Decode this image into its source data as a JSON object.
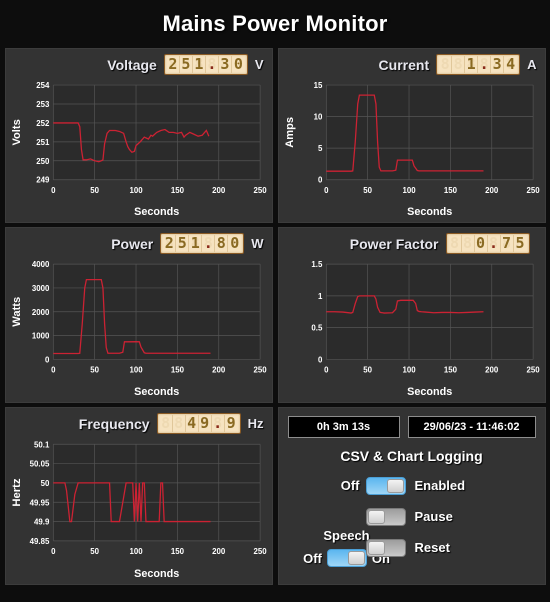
{
  "app": {
    "title": "Mains Power Monitor"
  },
  "panels": {
    "voltage": {
      "label": "Voltage",
      "value": "251.30",
      "unit": "V",
      "lcd_cells": 6
    },
    "current": {
      "label": "Current",
      "value": "1.34",
      "unit": "A",
      "lcd_cells": 6
    },
    "power": {
      "label": "Power",
      "value": "251.80",
      "unit": "W",
      "lcd_cells": 6
    },
    "power_factor": {
      "label": "Power Factor",
      "value": "0.75",
      "unit": "",
      "lcd_cells": 6
    },
    "frequency": {
      "label": "Frequency",
      "value": "49.9",
      "unit": "Hz",
      "lcd_cells": 6
    }
  },
  "controls": {
    "timer": "0h 3m 13s",
    "clock": "29/06/23 - 11:46:02",
    "section_title": "CSV & Chart Logging",
    "logging_off_label": "Off",
    "logging_enabled_label": "Enabled",
    "logging_enabled_state": "on",
    "pause_label": "Pause",
    "pause_state": "off",
    "reset_label": "Reset",
    "reset_state": "off",
    "speech_label": "Speech",
    "speech_off_label": "Off",
    "speech_on_label": "On",
    "speech_state": "on"
  },
  "colors": {
    "background": "#0d0d0d",
    "panel": "#333333",
    "plot_bg": "#2b2b2b",
    "grid": "#555555",
    "trace": "#cc2233",
    "lcd_bg": "#f6e3c0",
    "lcd_on": "#8a6a22",
    "lcd_off": "#eed9b2",
    "toggle_on": "#5bb6ef",
    "text": "#ffffff"
  },
  "chart_data": [
    {
      "id": "voltage",
      "type": "line",
      "title": "Voltage",
      "xlabel": "Seconds",
      "ylabel": "Volts",
      "xlim": [
        0,
        250
      ],
      "ylim": [
        249,
        254
      ],
      "xticks": [
        0,
        50,
        100,
        150,
        200,
        250
      ],
      "yticks": [
        249,
        250,
        251,
        252,
        253,
        254
      ],
      "grid": true,
      "legend": "none",
      "series": [
        {
          "name": "Volts",
          "color": "#cc2233",
          "x": [
            0,
            5,
            10,
            15,
            20,
            25,
            30,
            32,
            34,
            36,
            40,
            45,
            50,
            55,
            58,
            60,
            62,
            65,
            68,
            70,
            75,
            80,
            85,
            88,
            90,
            92,
            95,
            98,
            100,
            105,
            110,
            115,
            118,
            120,
            125,
            130,
            135,
            140,
            145,
            150,
            155,
            158,
            160,
            165,
            170,
            175,
            180,
            185,
            188
          ],
          "values": [
            252.0,
            252.0,
            252.0,
            252.0,
            252.0,
            252.0,
            252.0,
            251.8,
            250.6,
            250.05,
            250.05,
            250.1,
            250.0,
            249.95,
            250.0,
            250.05,
            250.9,
            251.45,
            251.6,
            251.6,
            251.6,
            251.55,
            251.45,
            251.0,
            250.75,
            250.6,
            250.45,
            250.5,
            250.8,
            251.0,
            251.25,
            251.15,
            251.35,
            251.3,
            251.5,
            251.6,
            251.65,
            251.5,
            251.5,
            251.45,
            251.5,
            251.25,
            251.35,
            251.5,
            251.4,
            251.3,
            251.35,
            251.6,
            251.3
          ]
        }
      ]
    },
    {
      "id": "current",
      "type": "line",
      "title": "Current",
      "xlabel": "Seconds",
      "ylabel": "Amps",
      "xlim": [
        0,
        250
      ],
      "ylim": [
        0,
        15
      ],
      "xticks": [
        0,
        50,
        100,
        150,
        200,
        250
      ],
      "yticks": [
        0,
        5,
        10,
        15
      ],
      "grid": true,
      "legend": "none",
      "series": [
        {
          "name": "Amps",
          "color": "#cc2233",
          "x": [
            0,
            10,
            20,
            30,
            32,
            35,
            38,
            40,
            50,
            55,
            58,
            60,
            62,
            64,
            66,
            70,
            80,
            84,
            86,
            90,
            100,
            104,
            106,
            110,
            112,
            115,
            120,
            130,
            140,
            150,
            160,
            170,
            180,
            190
          ],
          "values": [
            1.35,
            1.35,
            1.35,
            1.35,
            1.4,
            6.0,
            12.0,
            13.4,
            13.4,
            13.4,
            13.4,
            12.0,
            6.0,
            2.0,
            1.4,
            1.4,
            1.4,
            1.5,
            3.1,
            3.1,
            3.1,
            3.1,
            2.2,
            1.45,
            1.4,
            1.4,
            1.4,
            1.4,
            1.4,
            1.4,
            1.4,
            1.4,
            1.4,
            1.4
          ]
        }
      ]
    },
    {
      "id": "power",
      "type": "line",
      "title": "Power",
      "xlabel": "Seconds",
      "ylabel": "Watts",
      "xlim": [
        0,
        250
      ],
      "ylim": [
        0,
        4000
      ],
      "xticks": [
        0,
        50,
        100,
        150,
        200,
        250
      ],
      "yticks": [
        0,
        1000,
        2000,
        3000,
        4000
      ],
      "grid": true,
      "legend": "none",
      "series": [
        {
          "name": "Watts",
          "color": "#cc2233",
          "x": [
            0,
            10,
            20,
            30,
            32,
            35,
            38,
            40,
            50,
            55,
            58,
            60,
            62,
            64,
            66,
            70,
            80,
            84,
            86,
            90,
            100,
            104,
            106,
            110,
            112,
            115,
            120,
            130,
            140,
            150,
            160,
            170,
            180,
            190
          ],
          "values": [
            250,
            250,
            250,
            250,
            260,
            1500,
            3000,
            3350,
            3350,
            3350,
            3350,
            3000,
            1500,
            500,
            260,
            260,
            260,
            300,
            740,
            740,
            745,
            740,
            520,
            280,
            260,
            260,
            260,
            260,
            260,
            260,
            260,
            260,
            260,
            260
          ]
        }
      ]
    },
    {
      "id": "power_factor",
      "type": "line",
      "title": "Power Factor",
      "xlabel": "Seconds",
      "ylabel": "",
      "xlim": [
        0,
        250
      ],
      "ylim": [
        0,
        1.5
      ],
      "xticks": [
        0,
        50,
        100,
        150,
        200,
        250
      ],
      "yticks": [
        0,
        0.5,
        1,
        1.5
      ],
      "grid": true,
      "legend": "none",
      "series": [
        {
          "name": "Power Factor",
          "color": "#cc2233",
          "x": [
            0,
            10,
            20,
            30,
            32,
            35,
            38,
            40,
            50,
            58,
            60,
            62,
            65,
            68,
            70,
            80,
            84,
            86,
            90,
            100,
            105,
            108,
            110,
            112,
            115,
            120,
            130,
            140,
            150,
            160,
            170,
            180,
            190
          ],
          "values": [
            0.75,
            0.75,
            0.745,
            0.73,
            0.74,
            0.88,
            0.99,
            1.0,
            1.0,
            1.0,
            0.95,
            0.82,
            0.74,
            0.735,
            0.73,
            0.735,
            0.79,
            0.92,
            0.93,
            0.93,
            0.93,
            0.88,
            0.77,
            0.755,
            0.75,
            0.745,
            0.735,
            0.74,
            0.74,
            0.735,
            0.74,
            0.745,
            0.75
          ]
        }
      ]
    },
    {
      "id": "frequency",
      "type": "line",
      "title": "Frequency",
      "xlabel": "Seconds",
      "ylabel": "Hertz",
      "xlim": [
        0,
        250
      ],
      "ylim": [
        49.85,
        50.1
      ],
      "xticks": [
        0,
        50,
        100,
        150,
        200,
        250
      ],
      "yticks": [
        49.85,
        49.9,
        49.95,
        50,
        50.05,
        50.1
      ],
      "grid": true,
      "legend": "none",
      "series": [
        {
          "name": "Hertz",
          "color": "#cc2233",
          "x": [
            0,
            14,
            16,
            20,
            22,
            26,
            30,
            68,
            70,
            72,
            76,
            80,
            88,
            90,
            96,
            98,
            100,
            102,
            104,
            106,
            108,
            110,
            112,
            114,
            118,
            120,
            128,
            130,
            132,
            134,
            136,
            140,
            150,
            160,
            170,
            180,
            190
          ],
          "values": [
            50,
            50,
            49.98,
            49.9,
            49.9,
            49.97,
            50,
            50,
            49.9,
            49.9,
            49.9,
            49.9,
            50,
            50,
            50,
            49.9,
            50,
            49.9,
            50,
            49.9,
            50,
            50,
            49.9,
            49.9,
            49.9,
            49.9,
            49.9,
            50,
            50,
            49.9,
            49.9,
            49.9,
            49.9,
            49.9,
            49.9,
            49.9,
            49.9
          ]
        }
      ]
    }
  ]
}
